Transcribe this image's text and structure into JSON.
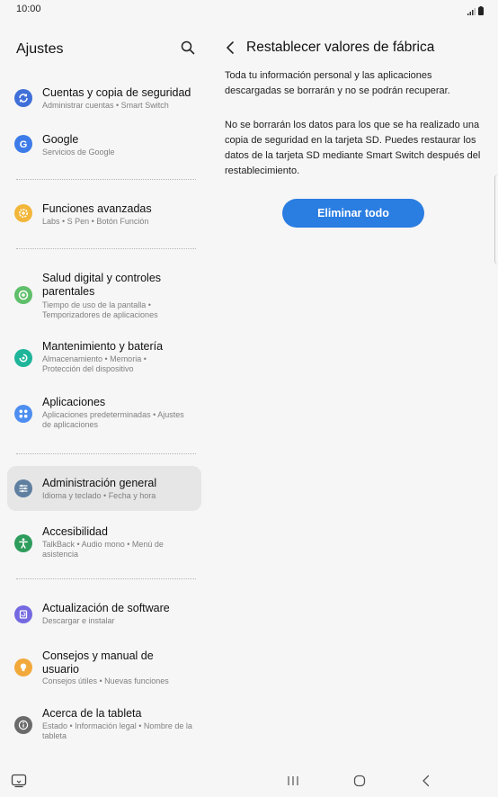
{
  "status_bar": {
    "time": "10:00",
    "icons": [
      "signal-icon",
      "battery-icon"
    ]
  },
  "left_panel": {
    "title": "Ajustes",
    "search_icon": "search-icon",
    "items": [
      {
        "title": "Cuentas y copia de seguridad",
        "subtitle": "Administrar cuentas  •  Smart Switch",
        "icon": "sync-icon",
        "color": "#3f6fd8"
      },
      {
        "title": "Google",
        "subtitle": "Servicios de Google",
        "icon": "google-icon",
        "color": "#3d7be8"
      },
      {
        "title": "Funciones avanzadas",
        "subtitle": "Labs  •  S Pen  •  Botón Función",
        "icon": "gear-plus-icon",
        "color": "#f2b63a"
      },
      {
        "title": "Salud digital y controles parentales",
        "subtitle": "Tiempo de uso de la pantalla  •  Temporizadores de aplicaciones",
        "icon": "digital-wellbeing-icon",
        "color": "#5fbf6a"
      },
      {
        "title": "Mantenimiento y batería",
        "subtitle": "Almacenamiento  •  Memoria  •  Protección del dispositivo",
        "icon": "device-care-icon",
        "color": "#1fb59a"
      },
      {
        "title": "Aplicaciones",
        "subtitle": "Aplicaciones predeterminadas  •  Ajustes de aplicaciones",
        "icon": "apps-icon",
        "color": "#4d8ef0"
      },
      {
        "title": "Administración general",
        "subtitle": "Idioma y teclado  •  Fecha y hora",
        "icon": "sliders-icon",
        "color": "#5f7fa0"
      },
      {
        "title": "Accesibilidad",
        "subtitle": "TalkBack  •  Audio mono  •  Menú de asistencia",
        "icon": "accessibility-icon",
        "color": "#2e9c5c"
      },
      {
        "title": "Actualización de software",
        "subtitle": "Descargar e instalar",
        "icon": "software-update-icon",
        "color": "#7469e0"
      },
      {
        "title": "Consejos y manual de usuario",
        "subtitle": "Consejos útiles  •  Nuevas funciones",
        "icon": "tips-icon",
        "color": "#f2a93b"
      },
      {
        "title": "Acerca de la tableta",
        "subtitle": "Estado  •  Información legal  •  Nombre de la tableta",
        "icon": "info-icon",
        "color": "#6b6b6b"
      }
    ]
  },
  "right_panel": {
    "back_icon": "back-arrow-icon",
    "title": "Restablecer valores de fábrica",
    "paragraph1": "Toda tu información personal y las aplicaciones descargadas se borrarán y no se podrán recuperar.",
    "paragraph2": "No se borrarán los datos para los que se ha realizado una copia de seguridad en la tarjeta SD. Puedes restaurar los datos de la tarjeta SD mediante Smart Switch después del restablecimiento.",
    "button_label": "Eliminar todo",
    "accent_color": "#2a7de1"
  },
  "nav_bar": {
    "icons": [
      "taskbar-icon",
      "recents-icon",
      "home-icon",
      "back-icon"
    ]
  }
}
